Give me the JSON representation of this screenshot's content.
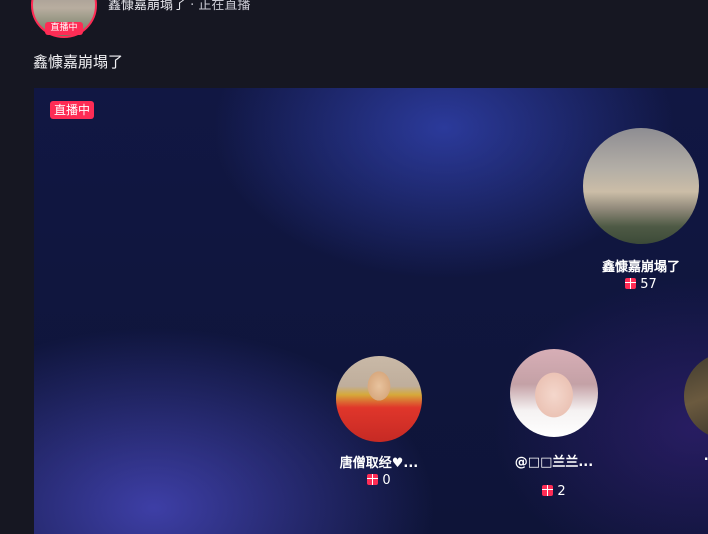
{
  "header": {
    "host_name": "鑫慷嘉崩塌了",
    "status_text": " · 正在直播",
    "live_badge": "直播中"
  },
  "room": {
    "title": "鑫慷嘉崩塌了"
  },
  "stage": {
    "live_badge": "直播中",
    "guests": [
      {
        "name": "鑫慷嘉崩塌了",
        "gifts": "57"
      },
      {
        "name": "唐僧取经♥...",
        "gifts": "0"
      },
      {
        "name": "@□□兰兰...",
        "gifts": "2"
      },
      {
        "name": "…",
        "gifts": ""
      }
    ]
  },
  "colors": {
    "accent": "#fe2c55",
    "page_bg": "#161722",
    "stage_bg": "#111743"
  },
  "icons": {
    "gift": "gift-icon"
  }
}
